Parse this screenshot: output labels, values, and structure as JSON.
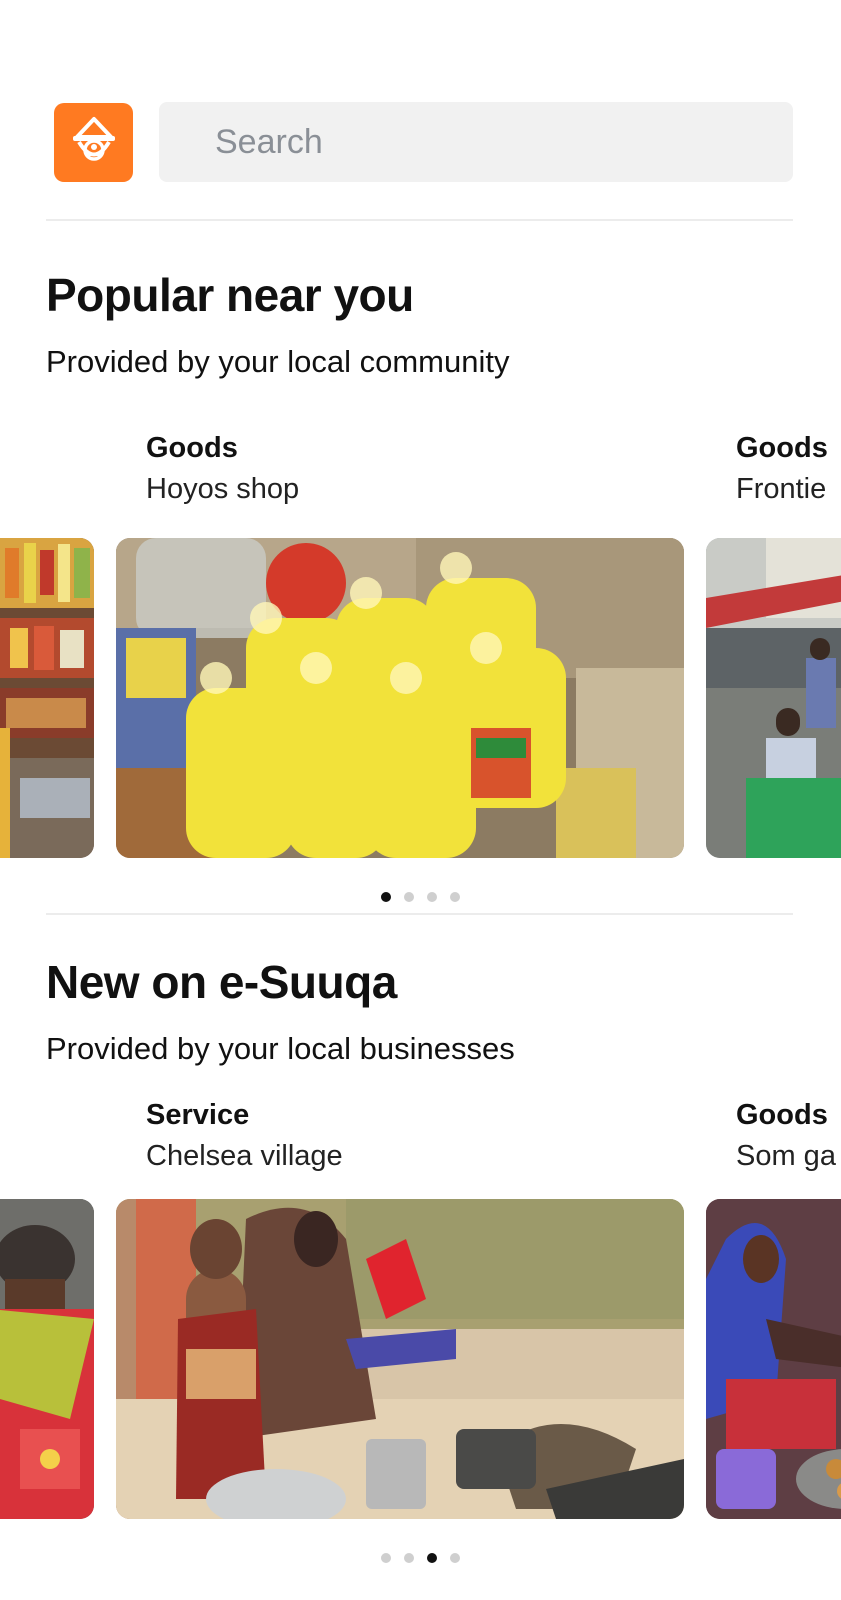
{
  "header": {
    "logo_icon": "basket-person-icon",
    "search_placeholder": "Search"
  },
  "colors": {
    "brand": "#ff7a21",
    "search_bg": "#f1f1f1",
    "dot_active": "#111111",
    "dot_inactive": "#cfcfcf"
  },
  "popular": {
    "title": "Popular near you",
    "subtitle": "Provided by your local community",
    "cards": [
      {
        "category": "Goods",
        "name": "Hoyos shop",
        "image": "yellow-oil-jerrycans-photo"
      },
      {
        "category": "Goods",
        "name": "Frontie",
        "image": "street-market-photo"
      }
    ],
    "prev_image": "market-stall-snacks-photo",
    "active_page": 1,
    "page_count": 4
  },
  "new_section": {
    "title": "New on e-Suuqa",
    "subtitle": "Provided by your local businesses",
    "cards": [
      {
        "category": "Service",
        "name": "Chelsea village",
        "image": "woman-cooking-child-photo"
      },
      {
        "category": "Goods",
        "name": "Som ga",
        "image": "woman-selling-food-photo"
      }
    ],
    "prev_image": "women-seated-market-photo",
    "active_page": 3,
    "page_count": 4
  }
}
